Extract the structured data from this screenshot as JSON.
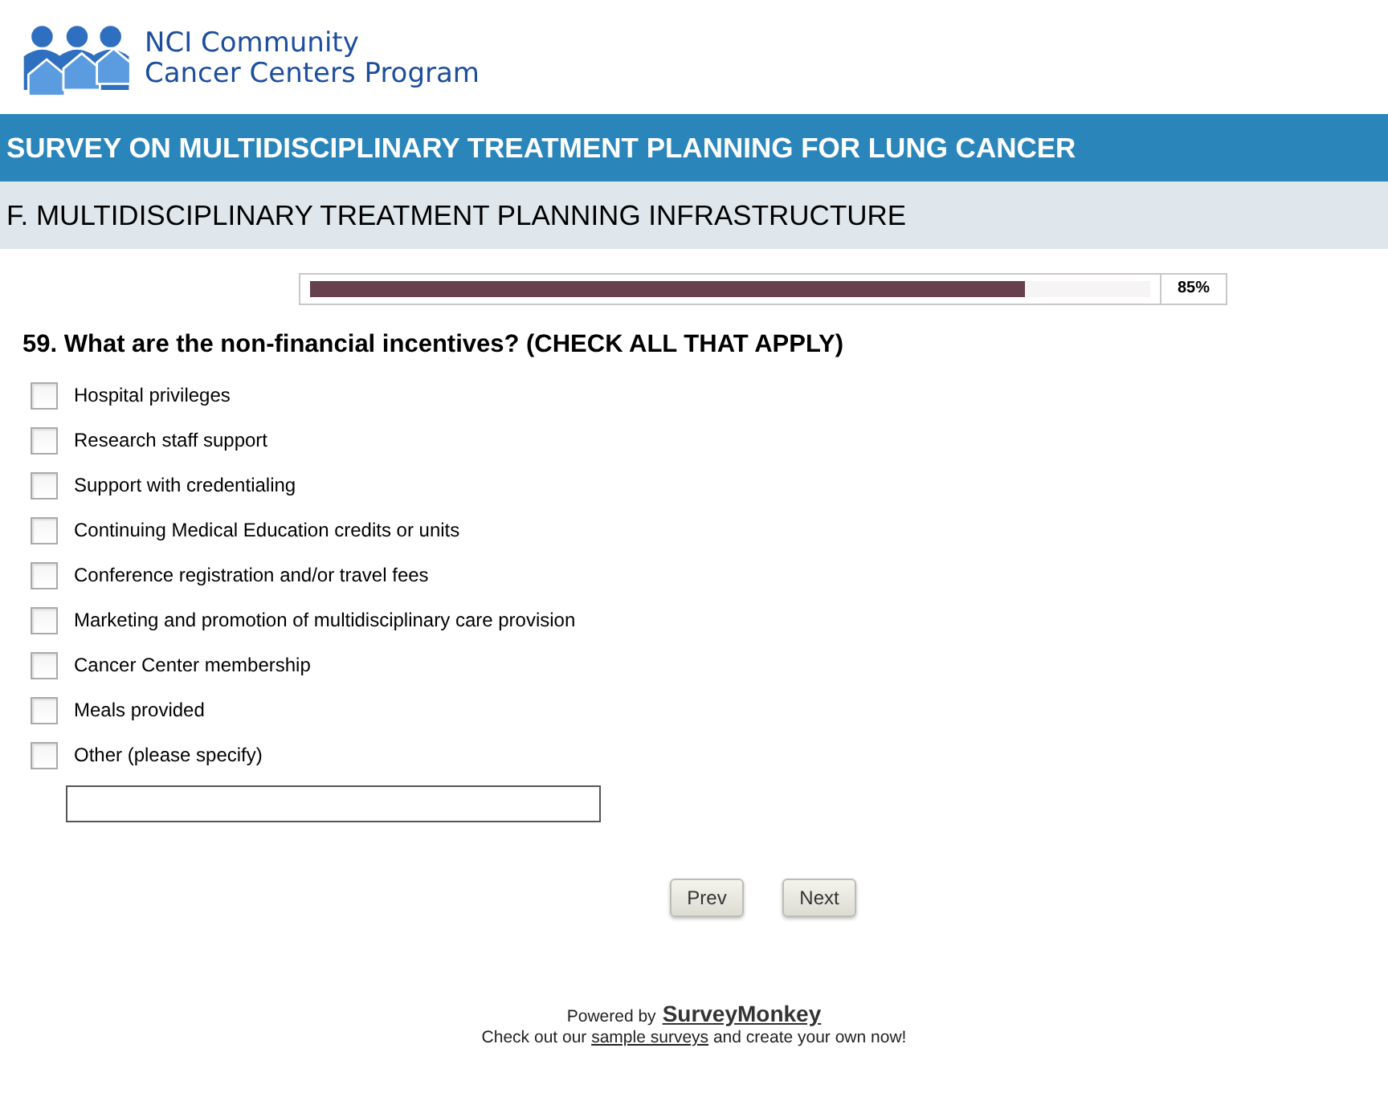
{
  "logo": {
    "line_1": "NCI Community",
    "line_2": "Cancer Centers Program"
  },
  "survey_title": "SURVEY ON MULTIDISCIPLINARY TREATMENT PLANNING FOR LUNG CANCER",
  "section_title": "F. MULTIDISCIPLINARY TREATMENT PLANNING INFRASTRUCTURE",
  "progress": {
    "level": 0.85,
    "reading": "85%"
  },
  "question": "59. What are the non-financial incentives? (CHECK ALL THAT APPLY)",
  "options": [
    {
      "label": "Hospital privileges",
      "checked": false
    },
    {
      "label": "Research staff support",
      "checked": false
    },
    {
      "label": "Support with credentialing",
      "checked": false
    },
    {
      "label": "Continuing Medical Education credits or units",
      "checked": false
    },
    {
      "label": "Conference registration and/or travel fees",
      "checked": false
    },
    {
      "label": "Marketing and promotion of multidisciplinary care provision",
      "checked": false
    },
    {
      "label": "Cancer Center membership",
      "checked": false
    },
    {
      "label": "Meals provided",
      "checked": false
    },
    {
      "label": "Other (please specify)",
      "checked": false
    }
  ],
  "buttons": [
    "Prev",
    "Next"
  ],
  "footer": {
    "powered_by": "Powered by",
    "brand_link": "SurveyMonkey",
    "prefix": "Check out our",
    "link": "sample surveys",
    "suffix": "and create your own now!"
  }
}
